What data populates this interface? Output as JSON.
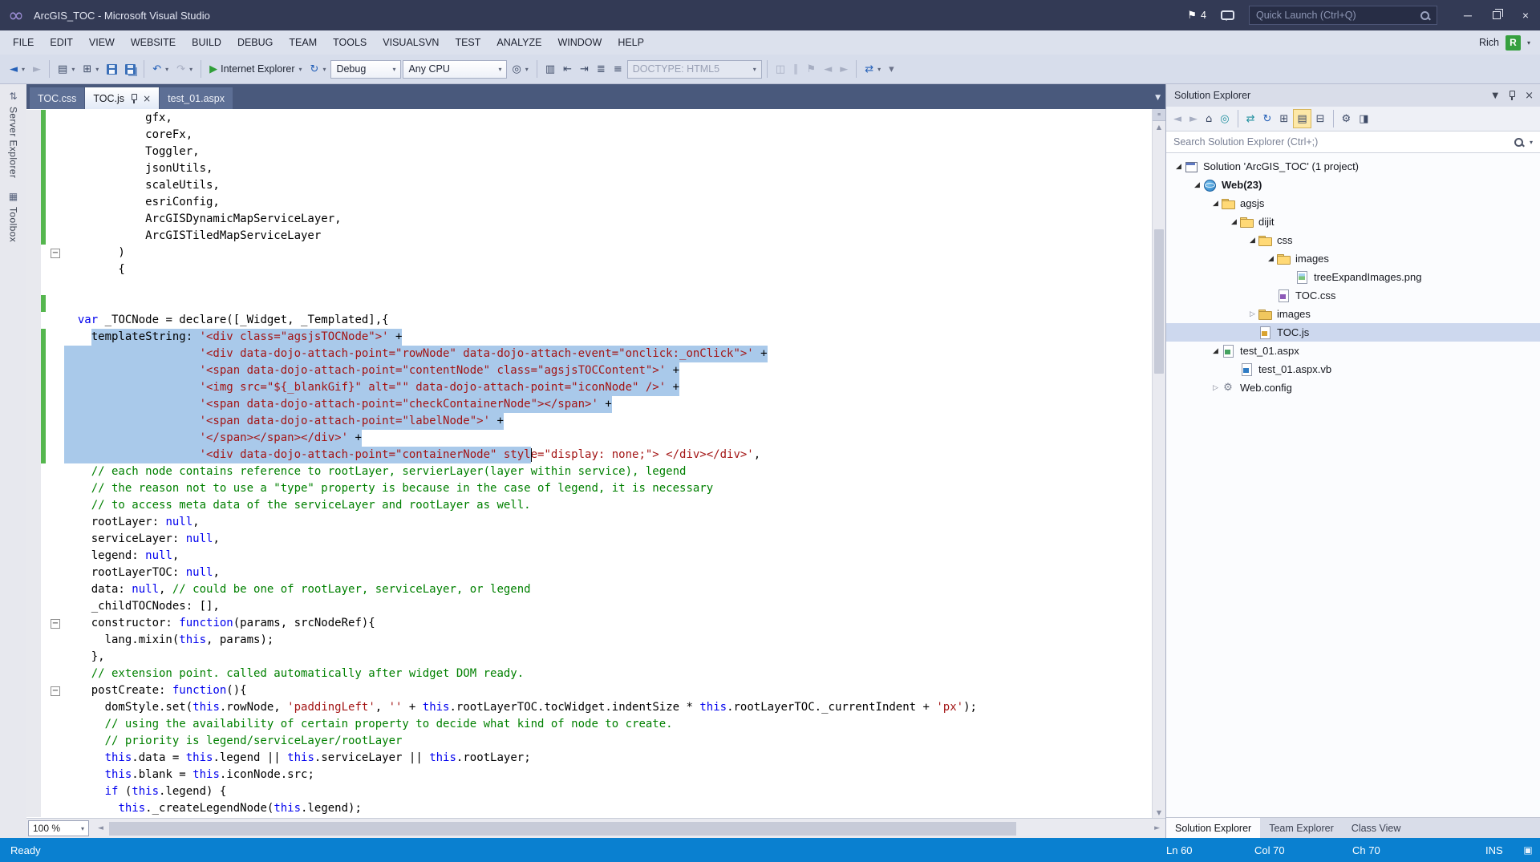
{
  "icons": {
    "vs_logo": "∞",
    "flag": "⚑",
    "minimize": "─",
    "close": "×",
    "dropdown": "▾",
    "header_dropdown": "▼",
    "tab_list_dropdown": "▼",
    "tree_expanded": "◢",
    "tree_collapsed": "▷",
    "gear": "⚙",
    "fold_collapse": "−",
    "scroll_up": "▲",
    "scroll_down": "▼",
    "scroll_left": "◄",
    "scroll_right": "►",
    "grip": "≡",
    "status_corner": "▣"
  },
  "title_bar": {
    "title": "ArcGIS_TOC - Microsoft Visual Studio",
    "notifications_count": "4",
    "quick_launch_placeholder": "Quick Launch (Ctrl+Q)"
  },
  "menu_bar": {
    "items": [
      "FILE",
      "EDIT",
      "VIEW",
      "WEBSITE",
      "BUILD",
      "DEBUG",
      "TEAM",
      "TOOLS",
      "VISUALSVN",
      "TEST",
      "ANALYZE",
      "WINDOW",
      "HELP"
    ],
    "user_name": "Rich",
    "avatar_initial": "R"
  },
  "toolbar": {
    "items": [
      {
        "name": "navigate-backward",
        "glyph": "◄",
        "style": "blue",
        "dd": true
      },
      {
        "name": "navigate-forward",
        "glyph": "►",
        "style": "dis"
      },
      {
        "sep": true
      },
      {
        "name": "new-web-page",
        "glyph": "▤",
        "dd": true
      },
      {
        "name": "add-new-item",
        "glyph": "⊞",
        "dd": true
      },
      {
        "name": "save",
        "cls": "floppy"
      },
      {
        "name": "save-all",
        "cls": "floppy2"
      },
      {
        "sep": true
      },
      {
        "name": "undo",
        "glyph": "↶",
        "style": "blue",
        "dd": true
      },
      {
        "name": "redo",
        "glyph": "↷",
        "style": "dis",
        "dd": true
      },
      {
        "sep": true
      },
      {
        "name": "start-debugging",
        "glyph": "▶",
        "style": "green",
        "label": "Internet Explorer",
        "dd": true
      },
      {
        "name": "browser-link-refresh",
        "glyph": "↻",
        "style": "blue",
        "dd": true
      },
      {
        "name": "combo-configuration",
        "combo": "Debug"
      },
      {
        "name": "combo-platform",
        "combo": "Any CPU"
      },
      {
        "name": "find-in-files",
        "glyph": "◎",
        "dd": true
      },
      {
        "sep": true
      },
      {
        "name": "format-document",
        "glyph": "▥"
      },
      {
        "name": "decrease-indent",
        "glyph": "⇤"
      },
      {
        "name": "increase-indent",
        "glyph": "⇥"
      },
      {
        "name": "comment-selection",
        "glyph": "≣"
      },
      {
        "name": "uncomment-selection",
        "glyph": "≡"
      },
      {
        "name": "combo-doctype",
        "combo": "DOCTYPE: HTML5",
        "disabled": true
      },
      {
        "sep": true
      },
      {
        "name": "split-view",
        "glyph": "◫",
        "style": "dis"
      },
      {
        "name": "word-wrap",
        "glyph": "∥",
        "style": "dis"
      },
      {
        "name": "toggle-bookmark",
        "glyph": "⚑",
        "style": "dis"
      },
      {
        "name": "previous-bookmark",
        "glyph": "◄",
        "style": "dis"
      },
      {
        "name": "next-bookmark",
        "glyph": "►",
        "style": "dis"
      },
      {
        "sep": true
      },
      {
        "name": "sync-publish",
        "glyph": "⇄",
        "style": "blue",
        "dd": true
      },
      {
        "name": "toolbar-overflow",
        "glyph": "▾",
        "style": "dim"
      }
    ]
  },
  "side_strip": {
    "tabs": [
      {
        "label": "Server Explorer",
        "icon": "⇅",
        "icon_name": "server-explorer-icon"
      },
      {
        "label": "Toolbox",
        "icon": "▦",
        "icon_name": "toolbox-icon"
      }
    ]
  },
  "editor": {
    "tabs": [
      {
        "label": "TOC.css",
        "active": false
      },
      {
        "label": "TOC.js",
        "active": true
      },
      {
        "label": "test_01.aspx",
        "active": false
      }
    ],
    "zoom": "100 %",
    "lines": [
      {
        "seg": [
          [
            "d",
            "            gfx,"
          ]
        ],
        "chg": true
      },
      {
        "seg": [
          [
            "d",
            "            coreFx,"
          ]
        ],
        "chg": true
      },
      {
        "seg": [
          [
            "d",
            "            Toggler,"
          ]
        ],
        "chg": true
      },
      {
        "seg": [
          [
            "d",
            "            jsonUtils,"
          ]
        ],
        "chg": true
      },
      {
        "seg": [
          [
            "d",
            "            scaleUtils,"
          ]
        ],
        "chg": true
      },
      {
        "seg": [
          [
            "d",
            "            esriConfig,"
          ]
        ],
        "chg": true
      },
      {
        "seg": [
          [
            "d",
            "            ArcGISDynamicMapServiceLayer,"
          ]
        ],
        "chg": true
      },
      {
        "seg": [
          [
            "d",
            "            ArcGISTiledMapServiceLayer"
          ]
        ],
        "chg": true
      },
      {
        "seg": [
          [
            "d",
            "        )"
          ]
        ],
        "fold": true
      },
      {
        "seg": [
          [
            "d",
            "        {"
          ]
        ]
      },
      {
        "seg": []
      },
      {
        "seg": [],
        "chg": true
      },
      {
        "seg": [
          [
            "d",
            "  "
          ],
          [
            "k",
            "var"
          ],
          [
            "d",
            " _TOCNode = declare([_Widget, _Templated],{"
          ]
        ]
      },
      {
        "seg": [
          [
            "d",
            "    templateString: "
          ],
          [
            "s",
            "'<div class=\"agsjsTOCNode\">'"
          ],
          [
            "d",
            " +"
          ]
        ],
        "sel": [
          4,
          -1
        ],
        "chg": true
      },
      {
        "seg": [
          [
            "d",
            "                    "
          ],
          [
            "s",
            "'<div data-dojo-attach-point=\"rowNode\" data-dojo-attach-event=\"onclick:_onClick\">'"
          ],
          [
            "d",
            " +"
          ]
        ],
        "sel": [
          0,
          -1
        ],
        "chg": true
      },
      {
        "seg": [
          [
            "d",
            "                    "
          ],
          [
            "s",
            "'<span data-dojo-attach-point=\"contentNode\" class=\"agsjsTOCContent\">'"
          ],
          [
            "d",
            " +"
          ]
        ],
        "sel": [
          0,
          -1
        ],
        "chg": true
      },
      {
        "seg": [
          [
            "d",
            "                    "
          ],
          [
            "s",
            "'<img src=\"${_blankGif}\" alt=\"\" data-dojo-attach-point=\"iconNode\" />'"
          ],
          [
            "d",
            " +"
          ]
        ],
        "sel": [
          0,
          -1
        ],
        "chg": true
      },
      {
        "seg": [
          [
            "d",
            "                    "
          ],
          [
            "s",
            "'<span data-dojo-attach-point=\"checkContainerNode\"></span>'"
          ],
          [
            "d",
            " +"
          ]
        ],
        "sel": [
          0,
          -1
        ],
        "chg": true
      },
      {
        "seg": [
          [
            "d",
            "                    "
          ],
          [
            "s",
            "'<span data-dojo-attach-point=\"labelNode\">'"
          ],
          [
            "d",
            " +"
          ]
        ],
        "sel": [
          0,
          -1
        ],
        "chg": true
      },
      {
        "seg": [
          [
            "d",
            "                    "
          ],
          [
            "s",
            "'</span></span></div>'"
          ],
          [
            "d",
            " +"
          ]
        ],
        "sel": [
          0,
          -1
        ],
        "chg": true
      },
      {
        "seg": [
          [
            "d",
            "                    "
          ],
          [
            "s",
            "'<div data-dojo-attach-point=\"containerNode\" style=\"display: none;\"> </div></div>'"
          ],
          [
            "d",
            ","
          ]
        ],
        "sel": [
          0,
          69
        ],
        "caret": 69,
        "chg": true
      },
      {
        "seg": [
          [
            "c",
            "    // each node contains reference to rootLayer, servierLayer(layer within service), legend"
          ]
        ]
      },
      {
        "seg": [
          [
            "c",
            "    // the reason not to use a \"type\" property is because in the case of legend, it is necessary"
          ]
        ]
      },
      {
        "seg": [
          [
            "c",
            "    // to access meta data of the serviceLayer and rootLayer as well."
          ]
        ]
      },
      {
        "seg": [
          [
            "d",
            "    rootLayer: "
          ],
          [
            "k",
            "null"
          ],
          [
            "d",
            ","
          ]
        ]
      },
      {
        "seg": [
          [
            "d",
            "    serviceLayer: "
          ],
          [
            "k",
            "null"
          ],
          [
            "d",
            ","
          ]
        ]
      },
      {
        "seg": [
          [
            "d",
            "    legend: "
          ],
          [
            "k",
            "null"
          ],
          [
            "d",
            ","
          ]
        ]
      },
      {
        "seg": [
          [
            "d",
            "    rootLayerTOC: "
          ],
          [
            "k",
            "null"
          ],
          [
            "d",
            ","
          ]
        ]
      },
      {
        "seg": [
          [
            "d",
            "    data: "
          ],
          [
            "k",
            "null"
          ],
          [
            "d",
            ", "
          ],
          [
            "c",
            "// could be one of rootLayer, serviceLayer, or legend"
          ]
        ]
      },
      {
        "seg": [
          [
            "d",
            "    _childTOCNodes: [],"
          ]
        ]
      },
      {
        "seg": [
          [
            "d",
            "    constructor: "
          ],
          [
            "k",
            "function"
          ],
          [
            "d",
            "(params, srcNodeRef){"
          ]
        ],
        "fold": true
      },
      {
        "seg": [
          [
            "d",
            "      lang.mixin("
          ],
          [
            "k",
            "this"
          ],
          [
            "d",
            ", params);"
          ]
        ]
      },
      {
        "seg": [
          [
            "d",
            "    },"
          ]
        ]
      },
      {
        "seg": [
          [
            "c",
            "    // extension point. called automatically after widget DOM ready."
          ]
        ]
      },
      {
        "seg": [
          [
            "d",
            "    postCreate: "
          ],
          [
            "k",
            "function"
          ],
          [
            "d",
            "(){"
          ]
        ],
        "fold": true
      },
      {
        "seg": [
          [
            "d",
            "      domStyle.set("
          ],
          [
            "k",
            "this"
          ],
          [
            "d",
            ".rowNode, "
          ],
          [
            "s",
            "'paddingLeft'"
          ],
          [
            "d",
            ", "
          ],
          [
            "s",
            "''"
          ],
          [
            "d",
            " + "
          ],
          [
            "k",
            "this"
          ],
          [
            "d",
            ".rootLayerTOC.tocWidget.indentSize * "
          ],
          [
            "k",
            "this"
          ],
          [
            "d",
            ".rootLayerTOC._currentIndent + "
          ],
          [
            "s",
            "'px'"
          ],
          [
            "d",
            ");"
          ]
        ]
      },
      {
        "seg": [
          [
            "c",
            "      // using the availability of certain property to decide what kind of node to create."
          ]
        ]
      },
      {
        "seg": [
          [
            "c",
            "      // priority is legend/serviceLayer/rootLayer"
          ]
        ]
      },
      {
        "seg": [
          [
            "d",
            "      "
          ],
          [
            "k",
            "this"
          ],
          [
            "d",
            ".data = "
          ],
          [
            "k",
            "this"
          ],
          [
            "d",
            ".legend || "
          ],
          [
            "k",
            "this"
          ],
          [
            "d",
            ".serviceLayer || "
          ],
          [
            "k",
            "this"
          ],
          [
            "d",
            ".rootLayer;"
          ]
        ]
      },
      {
        "seg": [
          [
            "d",
            "      "
          ],
          [
            "k",
            "this"
          ],
          [
            "d",
            ".blank = "
          ],
          [
            "k",
            "this"
          ],
          [
            "d",
            ".iconNode.src;"
          ]
        ]
      },
      {
        "seg": [
          [
            "d",
            "      "
          ],
          [
            "k",
            "if"
          ],
          [
            "d",
            " ("
          ],
          [
            "k",
            "this"
          ],
          [
            "d",
            ".legend) {"
          ]
        ]
      },
      {
        "seg": [
          [
            "d",
            "        "
          ],
          [
            "k",
            "this"
          ],
          [
            "d",
            "._createLegendNode("
          ],
          [
            "k",
            "this"
          ],
          [
            "d",
            ".legend);"
          ]
        ]
      }
    ]
  },
  "solution_explorer": {
    "title": "Solution Explorer",
    "search_placeholder": "Search Solution Explorer (Ctrl+;)",
    "toolbar_items": [
      {
        "name": "se-navigate-back",
        "glyph": "◄",
        "style": "dis"
      },
      {
        "name": "se-navigate-forward",
        "glyph": "►",
        "style": "dis"
      },
      {
        "name": "se-home",
        "glyph": "⌂"
      },
      {
        "name": "se-switch-views",
        "glyph": "◎",
        "style": "teal"
      },
      {
        "sep": true
      },
      {
        "name": "se-sync-with-active-document",
        "glyph": "⇄",
        "style": "teal"
      },
      {
        "name": "se-refresh",
        "glyph": "↻",
        "style": "blue"
      },
      {
        "name": "se-new-view",
        "glyph": "⊞"
      },
      {
        "name": "se-show-all-files",
        "glyph": "▤",
        "toggled": true
      },
      {
        "name": "se-collapse-all",
        "glyph": "⊟"
      },
      {
        "sep": true
      },
      {
        "name": "se-properties",
        "glyph": "⚙"
      },
      {
        "name": "se-preview-selected",
        "glyph": "◨"
      }
    ],
    "tree": [
      {
        "label": "Solution 'ArcGIS_TOC' (1 project)",
        "level": 0,
        "icon": "solution",
        "expander": "open"
      },
      {
        "label": "Web(23)",
        "level": 1,
        "icon": "globe",
        "expander": "open",
        "bold": true
      },
      {
        "label": "agsjs",
        "level": 2,
        "icon": "folder-open",
        "expander": "open"
      },
      {
        "label": "dijit",
        "level": 3,
        "icon": "folder-open",
        "expander": "open"
      },
      {
        "label": "css",
        "level": 4,
        "icon": "folder-open",
        "expander": "open"
      },
      {
        "label": "images",
        "level": 5,
        "icon": "folder-open",
        "expander": "open"
      },
      {
        "label": "treeExpandImages.png",
        "level": 6,
        "icon": "image"
      },
      {
        "label": "TOC.css",
        "level": 5,
        "icon": "css"
      },
      {
        "label": "images",
        "level": 4,
        "icon": "folder",
        "expander": "closed"
      },
      {
        "label": "TOC.js",
        "level": 4,
        "icon": "js",
        "selected": true
      },
      {
        "label": "test_01.aspx",
        "level": 2,
        "icon": "aspx",
        "expander": "open"
      },
      {
        "label": "test_01.aspx.vb",
        "level": 3,
        "icon": "vb"
      },
      {
        "label": "Web.config",
        "level": 2,
        "icon": "config",
        "expander": "closed"
      }
    ],
    "bottom_tabs": [
      {
        "label": "Solution Explorer",
        "active": true
      },
      {
        "label": "Team Explorer",
        "active": false
      },
      {
        "label": "Class View",
        "active": false
      }
    ]
  },
  "status_bar": {
    "message": "Ready",
    "items": [
      "Ln 60",
      "Col 70",
      "Ch 70",
      "INS"
    ]
  }
}
